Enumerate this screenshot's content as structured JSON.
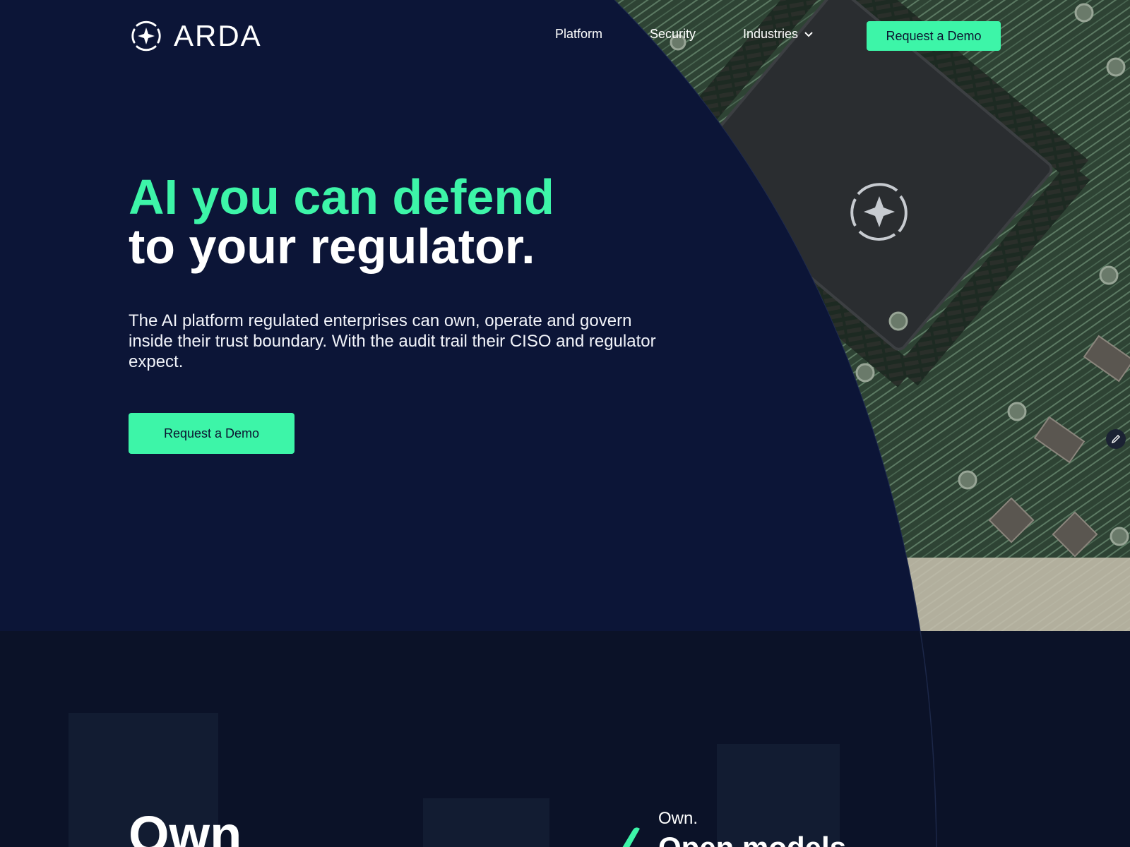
{
  "brand": {
    "name": "ARDA",
    "logo_icon": "crosshair-star-icon"
  },
  "nav": {
    "items": [
      {
        "label": "Platform"
      },
      {
        "label": "Security"
      },
      {
        "label": "Industries",
        "icon": "chevron-down-icon"
      }
    ],
    "cta": "Request a Demo"
  },
  "hero": {
    "headline_line1": "AI you can defend",
    "headline_line2": "to your regulator.",
    "subtext": "The AI platform regulated enterprises can own, operate and govern inside their trust boundary. With the audit trail their CISO and regulator expect.",
    "cta": "Request a Demo",
    "image_chip_icon": "crosshair-star-icon"
  },
  "lower": {
    "big_heading": "Own",
    "small_label": "Own.",
    "feature_heading": "Open models"
  },
  "colors": {
    "accent": "#3df5a8",
    "hero_bg": "#0c1537",
    "lower_bg": "#0b1228",
    "pcb_green": "#2f4637"
  },
  "icons": {
    "edit_fab": "pencil-icon"
  }
}
